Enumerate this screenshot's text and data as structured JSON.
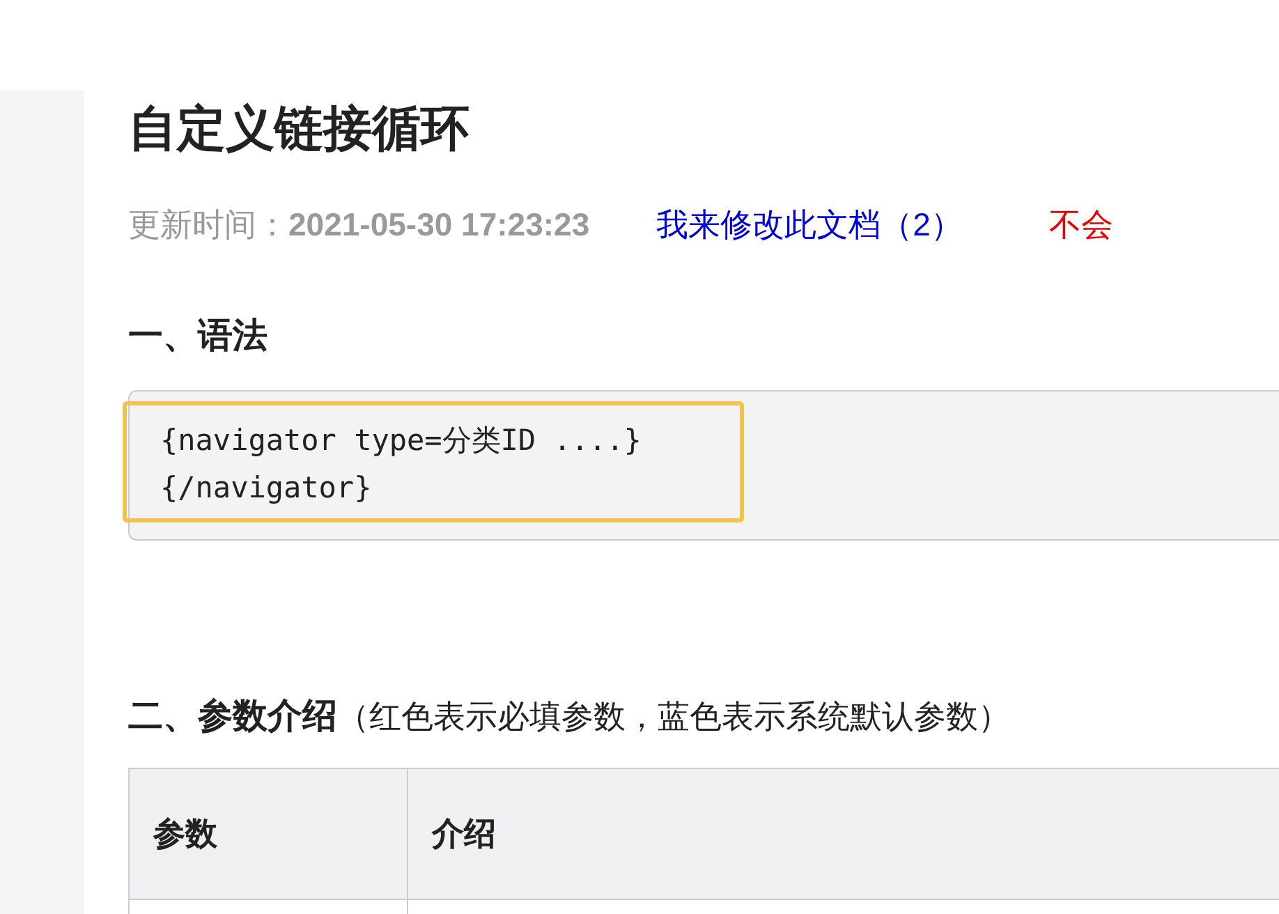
{
  "title": "自定义链接循环",
  "meta": {
    "label": "更新时间：",
    "timestamp": "2021-05-30 17:23:23",
    "edit_link": "我来修改此文档（2）",
    "help_link": "不会"
  },
  "sections": [
    {
      "heading": "一、语法",
      "code": [
        "{navigator type=分类ID ....}",
        "{/navigator}"
      ]
    },
    {
      "heading": "二、参数介绍",
      "note": "（红色表示必填参数，蓝色表示系统默认参数）",
      "table": {
        "columns": [
          "参数",
          "介绍"
        ]
      }
    }
  ]
}
